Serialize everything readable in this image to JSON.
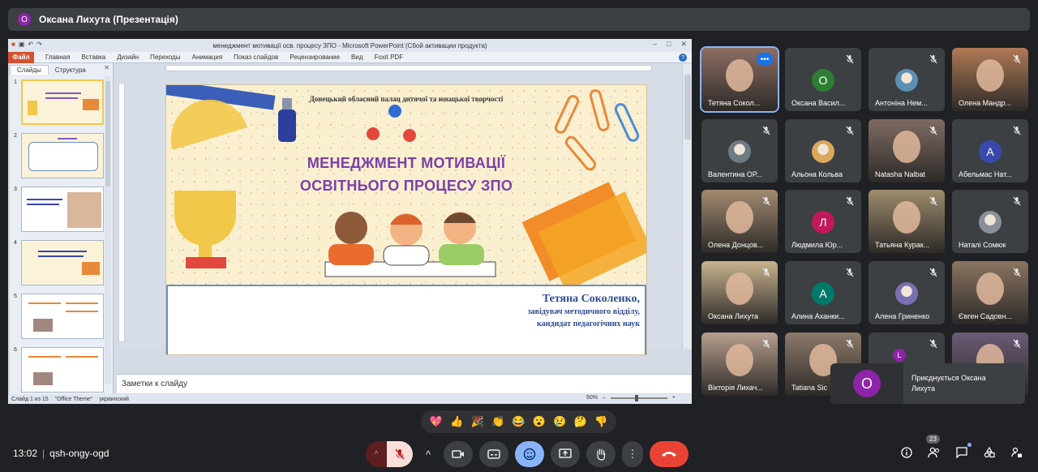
{
  "topbar": {
    "avatar": "О",
    "title": "Оксана Лихута (Презентація)"
  },
  "ppt": {
    "window_title": "менеджмент мотивації осв. процесу ЗПО - Microsoft PowerPoint (Сбой активации продукта)",
    "tabs": [
      "Файл",
      "Главная",
      "Вставка",
      "Дизайн",
      "Переходы",
      "Анимация",
      "Показ слайдов",
      "Рецензирование",
      "Вид",
      "Foxit PDF"
    ],
    "panel_tabs": [
      "Слайды",
      "Структура"
    ],
    "slide_numbers": [
      "1",
      "2",
      "3",
      "4",
      "5",
      "6"
    ],
    "notes_placeholder": "Заметки к слайду",
    "status": {
      "slide": "Слайд 1 из 15",
      "theme": "\"Office Theme\"",
      "language": "украинский",
      "zoom": "50%"
    }
  },
  "slide": {
    "org": "Донецький обласний палац дитячої та юнацької творчості",
    "title_line1": "МЕНЕДЖМЕНТ МОТИВАЦІЇ",
    "title_line2": "ОСВІТНЬОГО ПРОЦЕСУ  ЗПО",
    "author_name": "Тетяна Соколенко,",
    "author_position": "завідувач методичного відділу,",
    "author_degree": "кандидат педагогічних наук"
  },
  "participants": [
    {
      "name": "Тетяна Сокол...",
      "kind": "video",
      "color": "#8d6e63"
    },
    {
      "name": "Оксана Васил...",
      "kind": "letter",
      "letter": "О",
      "color": "#2e7d32"
    },
    {
      "name": "Антоніна Нем...",
      "kind": "photo",
      "color": "#5c8fb3"
    },
    {
      "name": "Олена Мандр...",
      "kind": "video",
      "color": "#b07a55"
    },
    {
      "name": "Валентина ОР...",
      "kind": "photo",
      "color": "#6f7b84"
    },
    {
      "name": "Альона Кольва",
      "kind": "photo",
      "color": "#d9a85c"
    },
    {
      "name": "Natasha Nalbat",
      "kind": "video",
      "color": "#7e6b62"
    },
    {
      "name": "Абельмас Нат...",
      "kind": "letter",
      "letter": "A",
      "color": "#3949ab"
    },
    {
      "name": "Олена Донцов...",
      "kind": "video",
      "color": "#a38b70"
    },
    {
      "name": "Людмила Юр...",
      "kind": "letter",
      "letter": "Л",
      "color": "#c2185b"
    },
    {
      "name": "Татьяна Курак...",
      "kind": "video",
      "color": "#9e8d6d"
    },
    {
      "name": "Наталі Сомюк",
      "kind": "photo",
      "color": "#8a8f99"
    },
    {
      "name": "Оксана Лихута",
      "kind": "video",
      "color": "#c8b48f"
    },
    {
      "name": "Алина Аханки...",
      "kind": "letter",
      "letter": "A",
      "color": "#00796b"
    },
    {
      "name": "Алена Гриненко",
      "kind": "photo",
      "color": "#7a6fb0"
    },
    {
      "name": "Євген Садовн...",
      "kind": "video",
      "color": "#8a7561"
    },
    {
      "name": "Вікторія Лихач...",
      "kind": "video",
      "color": "#b79f8e"
    },
    {
      "name": "Tatiana Sic",
      "kind": "video",
      "color": "#8c7a6a"
    },
    {
      "name": "",
      "kind": "group",
      "letter": "L",
      "color": "#8e24aa"
    },
    {
      "name": "",
      "kind": "video",
      "color": "#6b5c77"
    }
  ],
  "toast": {
    "avatar": "О",
    "text": "Приєднується Оксана Лихута"
  },
  "reactions": [
    "💖",
    "👍",
    "🎉",
    "👏",
    "😂",
    "😮",
    "😢",
    "🤔",
    "👎"
  ],
  "bottom": {
    "time": "13:02",
    "meeting_code": "qsh-ongy-ogd",
    "participant_count": "23"
  },
  "colors": {
    "meet_bg": "#202124",
    "tile_bg": "#3c4043",
    "leave": "#ea4335",
    "active": "#8ab4f8",
    "slide_title": "#7b3fa8"
  }
}
